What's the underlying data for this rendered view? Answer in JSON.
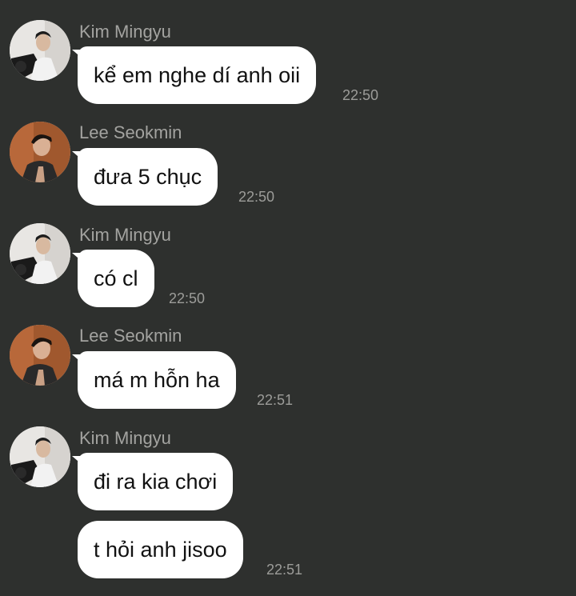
{
  "messages": [
    {
      "sender": "Kim Mingyu",
      "text": "kể em nghe dí anh oii",
      "time": "22:50"
    },
    {
      "sender": "Lee Seokmin",
      "text": "đưa 5 chục",
      "time": "22:50"
    },
    {
      "sender": "Kim Mingyu",
      "text": "có cl",
      "time": "22:50"
    },
    {
      "sender": "Lee Seokmin",
      "text": "má m hỗn ha",
      "time": "22:51"
    },
    {
      "sender": "Kim Mingyu",
      "text": "đi ra kia chơi"
    },
    {
      "text": "t hỏi anh jisoo",
      "time": "22:51"
    }
  ],
  "colors": {
    "background": "#2e302e",
    "bubble": "#ffffff",
    "sender_name": "#a3a3a0",
    "timestamp": "#9c9c99"
  },
  "icons": {
    "avatar_kim": "avatar-photo",
    "avatar_lee": "avatar-photo"
  }
}
